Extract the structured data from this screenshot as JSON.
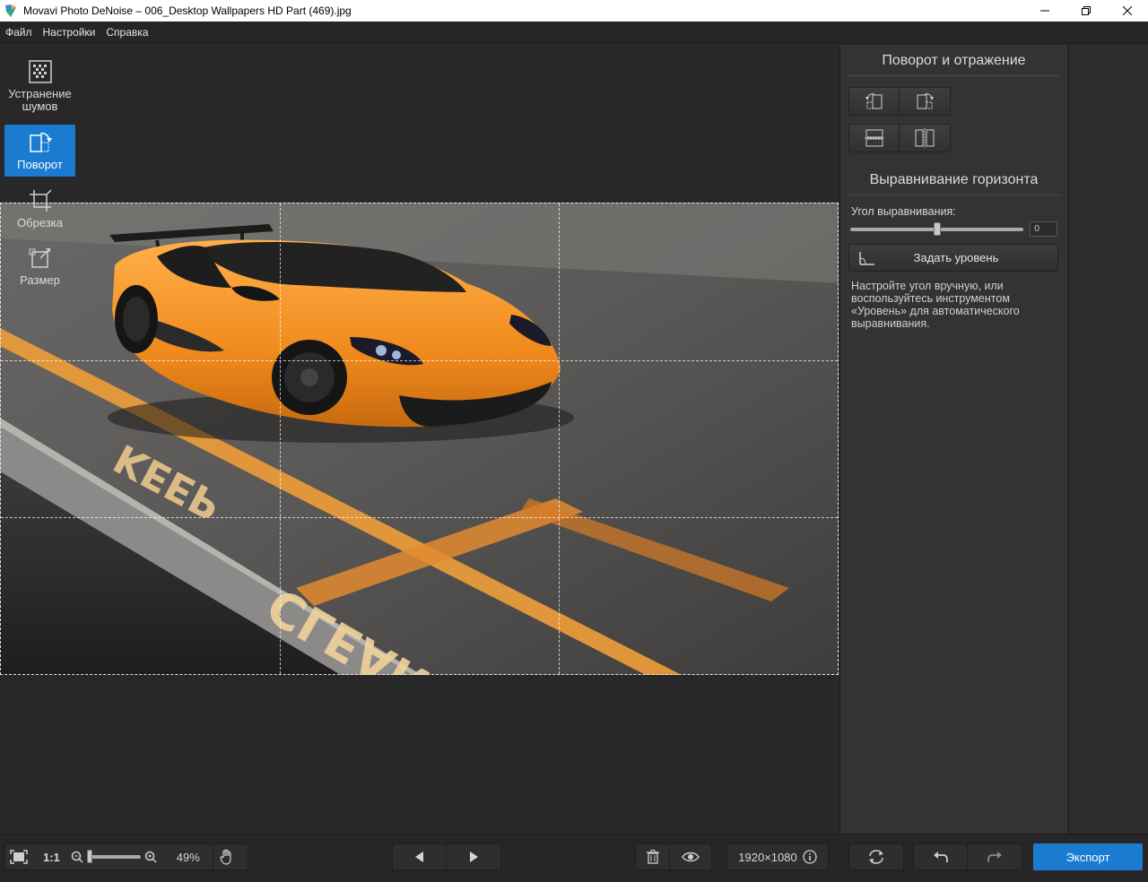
{
  "window": {
    "title": "Movavi Photo DeNoise – 006_Desktop Wallpapers  HD Part (469).jpg",
    "minimize_icon": "minimize-icon",
    "maximize_icon": "restore-icon",
    "close_icon": "close-icon"
  },
  "menu": {
    "items": [
      "Файл",
      "Настройки",
      "Справка"
    ]
  },
  "panel": {
    "rotate_title": "Поворот и отражение",
    "horizon_title": "Выравнивание горизонта",
    "angle_label": "Угол выравнивания:",
    "angle_value": "0",
    "angle_slider_fraction": 0.5,
    "level_button": "Задать уровень",
    "help_text": "Настройте угол вручную, или воспользуйтесь инструментом «Уровень» для автоматического выравнивания."
  },
  "tools": [
    {
      "label": "Устранение шумов",
      "icon": "denoise-icon",
      "active": false
    },
    {
      "label": "Поворот",
      "icon": "rotate-icon",
      "active": true
    },
    {
      "label": "Обрезка",
      "icon": "crop-icon",
      "active": false
    },
    {
      "label": "Размер",
      "icon": "resize-icon",
      "active": false
    }
  ],
  "bottom": {
    "fit_icon": "fit-to-screen-icon",
    "one_to_one": "1:1",
    "zoom_percent": "49%",
    "zoom_fraction": 0.05,
    "hand_icon": "hand-icon",
    "prev_icon": "prev-icon",
    "next_icon": "next-icon",
    "delete_icon": "trash-icon",
    "preview_icon": "eye-icon",
    "dimensions": "1920×1080",
    "info_icon": "info-icon",
    "reset_icon": "reset-icon",
    "undo_icon": "undo-icon",
    "redo_icon": "redo-icon",
    "export_label": "Экспорт"
  },
  "colors": {
    "accent": "#1b7bd0",
    "car": "#f08a1c",
    "road_marking": "#e89a3a"
  }
}
